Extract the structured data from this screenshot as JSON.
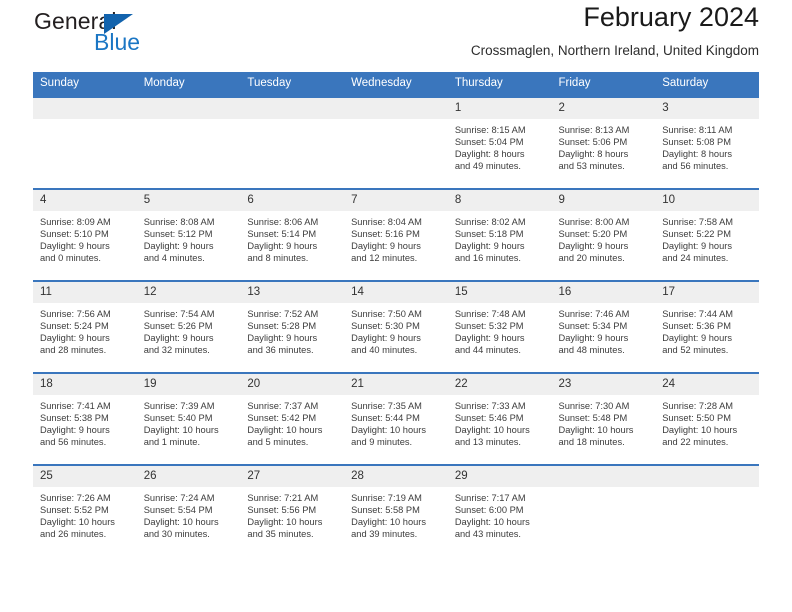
{
  "brand": {
    "name_part1": "General",
    "name_part2": "Blue",
    "flag_icon": "triangle-flag-icon"
  },
  "header": {
    "title": "February 2024",
    "location": "Crossmaglen, Northern Ireland, United Kingdom"
  },
  "colors": {
    "header_blue": "#3a76bd",
    "brand_blue": "#1b76c4",
    "daynum_band": "#efefef"
  },
  "weekdays": [
    "Sunday",
    "Monday",
    "Tuesday",
    "Wednesday",
    "Thursday",
    "Friday",
    "Saturday"
  ],
  "labels": {
    "sunrise": "Sunrise:",
    "sunset": "Sunset:",
    "daylight": "Daylight:"
  },
  "weeks": [
    [
      {
        "day": "",
        "blank": true
      },
      {
        "day": "",
        "blank": true
      },
      {
        "day": "",
        "blank": true
      },
      {
        "day": "",
        "blank": true
      },
      {
        "day": "1",
        "sunrise": "Sunrise: 8:15 AM",
        "sunset": "Sunset: 5:04 PM",
        "daylight_l1": "Daylight: 8 hours",
        "daylight_l2": "and 49 minutes."
      },
      {
        "day": "2",
        "sunrise": "Sunrise: 8:13 AM",
        "sunset": "Sunset: 5:06 PM",
        "daylight_l1": "Daylight: 8 hours",
        "daylight_l2": "and 53 minutes."
      },
      {
        "day": "3",
        "sunrise": "Sunrise: 8:11 AM",
        "sunset": "Sunset: 5:08 PM",
        "daylight_l1": "Daylight: 8 hours",
        "daylight_l2": "and 56 minutes."
      }
    ],
    [
      {
        "day": "4",
        "sunrise": "Sunrise: 8:09 AM",
        "sunset": "Sunset: 5:10 PM",
        "daylight_l1": "Daylight: 9 hours",
        "daylight_l2": "and 0 minutes."
      },
      {
        "day": "5",
        "sunrise": "Sunrise: 8:08 AM",
        "sunset": "Sunset: 5:12 PM",
        "daylight_l1": "Daylight: 9 hours",
        "daylight_l2": "and 4 minutes."
      },
      {
        "day": "6",
        "sunrise": "Sunrise: 8:06 AM",
        "sunset": "Sunset: 5:14 PM",
        "daylight_l1": "Daylight: 9 hours",
        "daylight_l2": "and 8 minutes."
      },
      {
        "day": "7",
        "sunrise": "Sunrise: 8:04 AM",
        "sunset": "Sunset: 5:16 PM",
        "daylight_l1": "Daylight: 9 hours",
        "daylight_l2": "and 12 minutes."
      },
      {
        "day": "8",
        "sunrise": "Sunrise: 8:02 AM",
        "sunset": "Sunset: 5:18 PM",
        "daylight_l1": "Daylight: 9 hours",
        "daylight_l2": "and 16 minutes."
      },
      {
        "day": "9",
        "sunrise": "Sunrise: 8:00 AM",
        "sunset": "Sunset: 5:20 PM",
        "daylight_l1": "Daylight: 9 hours",
        "daylight_l2": "and 20 minutes."
      },
      {
        "day": "10",
        "sunrise": "Sunrise: 7:58 AM",
        "sunset": "Sunset: 5:22 PM",
        "daylight_l1": "Daylight: 9 hours",
        "daylight_l2": "and 24 minutes."
      }
    ],
    [
      {
        "day": "11",
        "sunrise": "Sunrise: 7:56 AM",
        "sunset": "Sunset: 5:24 PM",
        "daylight_l1": "Daylight: 9 hours",
        "daylight_l2": "and 28 minutes."
      },
      {
        "day": "12",
        "sunrise": "Sunrise: 7:54 AM",
        "sunset": "Sunset: 5:26 PM",
        "daylight_l1": "Daylight: 9 hours",
        "daylight_l2": "and 32 minutes."
      },
      {
        "day": "13",
        "sunrise": "Sunrise: 7:52 AM",
        "sunset": "Sunset: 5:28 PM",
        "daylight_l1": "Daylight: 9 hours",
        "daylight_l2": "and 36 minutes."
      },
      {
        "day": "14",
        "sunrise": "Sunrise: 7:50 AM",
        "sunset": "Sunset: 5:30 PM",
        "daylight_l1": "Daylight: 9 hours",
        "daylight_l2": "and 40 minutes."
      },
      {
        "day": "15",
        "sunrise": "Sunrise: 7:48 AM",
        "sunset": "Sunset: 5:32 PM",
        "daylight_l1": "Daylight: 9 hours",
        "daylight_l2": "and 44 minutes."
      },
      {
        "day": "16",
        "sunrise": "Sunrise: 7:46 AM",
        "sunset": "Sunset: 5:34 PM",
        "daylight_l1": "Daylight: 9 hours",
        "daylight_l2": "and 48 minutes."
      },
      {
        "day": "17",
        "sunrise": "Sunrise: 7:44 AM",
        "sunset": "Sunset: 5:36 PM",
        "daylight_l1": "Daylight: 9 hours",
        "daylight_l2": "and 52 minutes."
      }
    ],
    [
      {
        "day": "18",
        "sunrise": "Sunrise: 7:41 AM",
        "sunset": "Sunset: 5:38 PM",
        "daylight_l1": "Daylight: 9 hours",
        "daylight_l2": "and 56 minutes."
      },
      {
        "day": "19",
        "sunrise": "Sunrise: 7:39 AM",
        "sunset": "Sunset: 5:40 PM",
        "daylight_l1": "Daylight: 10 hours",
        "daylight_l2": "and 1 minute."
      },
      {
        "day": "20",
        "sunrise": "Sunrise: 7:37 AM",
        "sunset": "Sunset: 5:42 PM",
        "daylight_l1": "Daylight: 10 hours",
        "daylight_l2": "and 5 minutes."
      },
      {
        "day": "21",
        "sunrise": "Sunrise: 7:35 AM",
        "sunset": "Sunset: 5:44 PM",
        "daylight_l1": "Daylight: 10 hours",
        "daylight_l2": "and 9 minutes."
      },
      {
        "day": "22",
        "sunrise": "Sunrise: 7:33 AM",
        "sunset": "Sunset: 5:46 PM",
        "daylight_l1": "Daylight: 10 hours",
        "daylight_l2": "and 13 minutes."
      },
      {
        "day": "23",
        "sunrise": "Sunrise: 7:30 AM",
        "sunset": "Sunset: 5:48 PM",
        "daylight_l1": "Daylight: 10 hours",
        "daylight_l2": "and 18 minutes."
      },
      {
        "day": "24",
        "sunrise": "Sunrise: 7:28 AM",
        "sunset": "Sunset: 5:50 PM",
        "daylight_l1": "Daylight: 10 hours",
        "daylight_l2": "and 22 minutes."
      }
    ],
    [
      {
        "day": "25",
        "sunrise": "Sunrise: 7:26 AM",
        "sunset": "Sunset: 5:52 PM",
        "daylight_l1": "Daylight: 10 hours",
        "daylight_l2": "and 26 minutes."
      },
      {
        "day": "26",
        "sunrise": "Sunrise: 7:24 AM",
        "sunset": "Sunset: 5:54 PM",
        "daylight_l1": "Daylight: 10 hours",
        "daylight_l2": "and 30 minutes."
      },
      {
        "day": "27",
        "sunrise": "Sunrise: 7:21 AM",
        "sunset": "Sunset: 5:56 PM",
        "daylight_l1": "Daylight: 10 hours",
        "daylight_l2": "and 35 minutes."
      },
      {
        "day": "28",
        "sunrise": "Sunrise: 7:19 AM",
        "sunset": "Sunset: 5:58 PM",
        "daylight_l1": "Daylight: 10 hours",
        "daylight_l2": "and 39 minutes."
      },
      {
        "day": "29",
        "sunrise": "Sunrise: 7:17 AM",
        "sunset": "Sunset: 6:00 PM",
        "daylight_l1": "Daylight: 10 hours",
        "daylight_l2": "and 43 minutes."
      },
      {
        "day": "",
        "blank": true
      },
      {
        "day": "",
        "blank": true
      }
    ]
  ]
}
